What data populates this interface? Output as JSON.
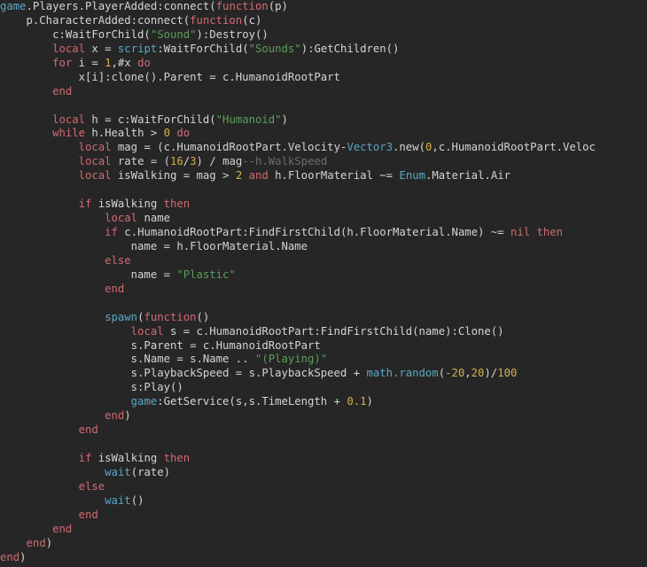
{
  "editor": {
    "language": "Lua",
    "background_color": "#262626",
    "foreground_color": "#d4d4d4",
    "font_size_px": 12,
    "line_height_px": 16,
    "tab_size": 4,
    "gutter_visible": false,
    "word_wrap": false,
    "theme_colors": {
      "keyword": "#d16a72",
      "builtin": "#5aa7c4",
      "string": "#5a9e5a",
      "number": "#d4b14a",
      "comment": "#6d6d6d",
      "plain": "#d4d4d4",
      "background": "#262626"
    }
  },
  "code": {
    "lines": [
      {
        "n": 1,
        "text": "game.Players.PlayerAdded:connect(function(p)"
      },
      {
        "n": 2,
        "text": "    p.CharacterAdded:connect(function(c)"
      },
      {
        "n": 3,
        "text": "        c:WaitForChild(\"Sound\"):Destroy()"
      },
      {
        "n": 4,
        "text": "        local x = script:WaitForChild(\"Sounds\"):GetChildren()"
      },
      {
        "n": 5,
        "text": "        for i = 1,#x do"
      },
      {
        "n": 6,
        "text": "            x[i]:clone().Parent = c.HumanoidRootPart"
      },
      {
        "n": 7,
        "text": "        end"
      },
      {
        "n": 8,
        "text": ""
      },
      {
        "n": 9,
        "text": "        local h = c:WaitForChild(\"Humanoid\")"
      },
      {
        "n": 10,
        "text": "        while h.Health > 0 do"
      },
      {
        "n": 11,
        "text": "            local mag = (c.HumanoidRootPart.Velocity-Vector3.new(0,c.HumanoidRootPart.Veloc"
      },
      {
        "n": 12,
        "text": "            local rate = (16/3) / mag--h.WalkSpeed"
      },
      {
        "n": 13,
        "text": "            local isWalking = mag > 2 and h.FloorMaterial ~= Enum.Material.Air"
      },
      {
        "n": 14,
        "text": ""
      },
      {
        "n": 15,
        "text": "            if isWalking then"
      },
      {
        "n": 16,
        "text": "                local name"
      },
      {
        "n": 17,
        "text": "                if c.HumanoidRootPart:FindFirstChild(h.FloorMaterial.Name) ~= nil then"
      },
      {
        "n": 18,
        "text": "                    name = h.FloorMaterial.Name"
      },
      {
        "n": 19,
        "text": "                else"
      },
      {
        "n": 20,
        "text": "                    name = \"Plastic\""
      },
      {
        "n": 21,
        "text": "                end"
      },
      {
        "n": 22,
        "text": ""
      },
      {
        "n": 23,
        "text": "                spawn(function()"
      },
      {
        "n": 24,
        "text": "                    local s = c.HumanoidRootPart:FindFirstChild(name):Clone()"
      },
      {
        "n": 25,
        "text": "                    s.Parent = c.HumanoidRootPart"
      },
      {
        "n": 26,
        "text": "                    s.Name = s.Name .. \"(Playing)\""
      },
      {
        "n": 27,
        "text": "                    s.PlaybackSpeed = s.PlaybackSpeed + math.random(-20,20)/100"
      },
      {
        "n": 28,
        "text": "                    s:Play()"
      },
      {
        "n": 29,
        "text": "                    game:GetService(s,s.TimeLength + 0.1)"
      },
      {
        "n": 30,
        "text": "                end)"
      },
      {
        "n": 31,
        "text": "            end"
      },
      {
        "n": 32,
        "text": ""
      },
      {
        "n": 33,
        "text": "            if isWalking then"
      },
      {
        "n": 34,
        "text": "                wait(rate)"
      },
      {
        "n": 35,
        "text": "            else"
      },
      {
        "n": 36,
        "text": "                wait()"
      },
      {
        "n": 37,
        "text": "            end"
      },
      {
        "n": 38,
        "text": "        end"
      },
      {
        "n": 39,
        "text": "    end)"
      },
      {
        "n": 40,
        "text": "end)"
      }
    ],
    "tokens": [
      [
        {
          "t": "game",
          "c": "bi"
        },
        {
          "t": ".Players.PlayerAdded:connect(",
          "c": "pln"
        },
        {
          "t": "function",
          "c": "kw"
        },
        {
          "t": "(p)",
          "c": "pln"
        }
      ],
      [
        {
          "t": "    p.CharacterAdded:connect(",
          "c": "pln"
        },
        {
          "t": "function",
          "c": "kw"
        },
        {
          "t": "(c)",
          "c": "pln"
        }
      ],
      [
        {
          "t": "        c:WaitForChild(",
          "c": "pln"
        },
        {
          "t": "\"Sound\"",
          "c": "str"
        },
        {
          "t": "):Destroy()",
          "c": "pln"
        }
      ],
      [
        {
          "t": "        ",
          "c": "pln"
        },
        {
          "t": "local",
          "c": "kw"
        },
        {
          "t": " x = ",
          "c": "pln"
        },
        {
          "t": "script",
          "c": "bi"
        },
        {
          "t": ":WaitForChild(",
          "c": "pln"
        },
        {
          "t": "\"Sounds\"",
          "c": "str"
        },
        {
          "t": "):GetChildren()",
          "c": "pln"
        }
      ],
      [
        {
          "t": "        ",
          "c": "pln"
        },
        {
          "t": "for",
          "c": "kw"
        },
        {
          "t": " i = ",
          "c": "pln"
        },
        {
          "t": "1",
          "c": "num"
        },
        {
          "t": ",#x ",
          "c": "pln"
        },
        {
          "t": "do",
          "c": "kw"
        }
      ],
      [
        {
          "t": "            x[i]:clone().Parent = c.HumanoidRootPart",
          "c": "pln"
        }
      ],
      [
        {
          "t": "        ",
          "c": "pln"
        },
        {
          "t": "end",
          "c": "kw"
        }
      ],
      [
        {
          "t": "",
          "c": "pln"
        }
      ],
      [
        {
          "t": "        ",
          "c": "pln"
        },
        {
          "t": "local",
          "c": "kw"
        },
        {
          "t": " h = c:WaitForChild(",
          "c": "pln"
        },
        {
          "t": "\"Humanoid\"",
          "c": "str"
        },
        {
          "t": ")",
          "c": "pln"
        }
      ],
      [
        {
          "t": "        ",
          "c": "pln"
        },
        {
          "t": "while",
          "c": "kw"
        },
        {
          "t": " h.Health > ",
          "c": "pln"
        },
        {
          "t": "0",
          "c": "num"
        },
        {
          "t": " ",
          "c": "pln"
        },
        {
          "t": "do",
          "c": "kw"
        }
      ],
      [
        {
          "t": "            ",
          "c": "pln"
        },
        {
          "t": "local",
          "c": "kw"
        },
        {
          "t": " mag = (c.HumanoidRootPart.Velocity-",
          "c": "pln"
        },
        {
          "t": "Vector3",
          "c": "bi"
        },
        {
          "t": ".new(",
          "c": "pln"
        },
        {
          "t": "0",
          "c": "num"
        },
        {
          "t": ",c.HumanoidRootPart.Veloc",
          "c": "pln"
        }
      ],
      [
        {
          "t": "            ",
          "c": "pln"
        },
        {
          "t": "local",
          "c": "kw"
        },
        {
          "t": " rate = (",
          "c": "pln"
        },
        {
          "t": "16",
          "c": "num"
        },
        {
          "t": "/",
          "c": "pln"
        },
        {
          "t": "3",
          "c": "num"
        },
        {
          "t": ") / mag",
          "c": "pln"
        },
        {
          "t": "--h.WalkSpeed",
          "c": "cmt"
        }
      ],
      [
        {
          "t": "            ",
          "c": "pln"
        },
        {
          "t": "local",
          "c": "kw"
        },
        {
          "t": " isWalking = mag > ",
          "c": "pln"
        },
        {
          "t": "2",
          "c": "num"
        },
        {
          "t": " ",
          "c": "pln"
        },
        {
          "t": "and",
          "c": "kw"
        },
        {
          "t": " h.FloorMaterial ~= ",
          "c": "pln"
        },
        {
          "t": "Enum",
          "c": "bi"
        },
        {
          "t": ".Material.Air",
          "c": "pln"
        }
      ],
      [
        {
          "t": "",
          "c": "pln"
        }
      ],
      [
        {
          "t": "            ",
          "c": "pln"
        },
        {
          "t": "if",
          "c": "kw"
        },
        {
          "t": " isWalking ",
          "c": "pln"
        },
        {
          "t": "then",
          "c": "kw"
        }
      ],
      [
        {
          "t": "                ",
          "c": "pln"
        },
        {
          "t": "local",
          "c": "kw"
        },
        {
          "t": " name",
          "c": "pln"
        }
      ],
      [
        {
          "t": "                ",
          "c": "pln"
        },
        {
          "t": "if",
          "c": "kw"
        },
        {
          "t": " c.HumanoidRootPart:FindFirstChild(h.FloorMaterial.Name) ~= ",
          "c": "pln"
        },
        {
          "t": "nil",
          "c": "kw"
        },
        {
          "t": " ",
          "c": "pln"
        },
        {
          "t": "then",
          "c": "kw"
        }
      ],
      [
        {
          "t": "                    name = h.FloorMaterial.Name",
          "c": "pln"
        }
      ],
      [
        {
          "t": "                ",
          "c": "pln"
        },
        {
          "t": "else",
          "c": "kw"
        }
      ],
      [
        {
          "t": "                    name = ",
          "c": "pln"
        },
        {
          "t": "\"Plastic\"",
          "c": "str"
        }
      ],
      [
        {
          "t": "                ",
          "c": "pln"
        },
        {
          "t": "end",
          "c": "kw"
        }
      ],
      [
        {
          "t": "",
          "c": "pln"
        }
      ],
      [
        {
          "t": "                ",
          "c": "pln"
        },
        {
          "t": "spawn",
          "c": "bi"
        },
        {
          "t": "(",
          "c": "pln"
        },
        {
          "t": "function",
          "c": "kw"
        },
        {
          "t": "()",
          "c": "pln"
        }
      ],
      [
        {
          "t": "                    ",
          "c": "pln"
        },
        {
          "t": "local",
          "c": "kw"
        },
        {
          "t": " s = c.HumanoidRootPart:FindFirstChild(name):Clone()",
          "c": "pln"
        }
      ],
      [
        {
          "t": "                    s.Parent = c.HumanoidRootPart",
          "c": "pln"
        }
      ],
      [
        {
          "t": "                    s.Name = s.Name .. ",
          "c": "pln"
        },
        {
          "t": "\"(Playing)\"",
          "c": "str"
        }
      ],
      [
        {
          "t": "                    s.PlaybackSpeed = s.PlaybackSpeed + ",
          "c": "pln"
        },
        {
          "t": "math.random",
          "c": "bi"
        },
        {
          "t": "(",
          "c": "pln"
        },
        {
          "t": "-20",
          "c": "num"
        },
        {
          "t": ",",
          "c": "pln"
        },
        {
          "t": "20",
          "c": "num"
        },
        {
          "t": ")/",
          "c": "pln"
        },
        {
          "t": "100",
          "c": "num"
        }
      ],
      [
        {
          "t": "                    s:Play()",
          "c": "pln"
        }
      ],
      [
        {
          "t": "                    ",
          "c": "pln"
        },
        {
          "t": "game",
          "c": "bi"
        },
        {
          "t": ":GetService(s,s.TimeLength + ",
          "c": "pln"
        },
        {
          "t": "0.1",
          "c": "num"
        },
        {
          "t": ")",
          "c": "pln"
        }
      ],
      [
        {
          "t": "                ",
          "c": "pln"
        },
        {
          "t": "end",
          "c": "kw"
        },
        {
          "t": ")",
          "c": "pln"
        }
      ],
      [
        {
          "t": "            ",
          "c": "pln"
        },
        {
          "t": "end",
          "c": "kw"
        }
      ],
      [
        {
          "t": "",
          "c": "pln"
        }
      ],
      [
        {
          "t": "            ",
          "c": "pln"
        },
        {
          "t": "if",
          "c": "kw"
        },
        {
          "t": " isWalking ",
          "c": "pln"
        },
        {
          "t": "then",
          "c": "kw"
        }
      ],
      [
        {
          "t": "                ",
          "c": "pln"
        },
        {
          "t": "wait",
          "c": "bi"
        },
        {
          "t": "(rate)",
          "c": "pln"
        }
      ],
      [
        {
          "t": "            ",
          "c": "pln"
        },
        {
          "t": "else",
          "c": "kw"
        }
      ],
      [
        {
          "t": "                ",
          "c": "pln"
        },
        {
          "t": "wait",
          "c": "bi"
        },
        {
          "t": "()",
          "c": "pln"
        }
      ],
      [
        {
          "t": "            ",
          "c": "pln"
        },
        {
          "t": "end",
          "c": "kw"
        }
      ],
      [
        {
          "t": "        ",
          "c": "pln"
        },
        {
          "t": "end",
          "c": "kw"
        }
      ],
      [
        {
          "t": "    ",
          "c": "pln"
        },
        {
          "t": "end",
          "c": "kw"
        },
        {
          "t": ")",
          "c": "pln"
        }
      ],
      [
        {
          "t": "",
          "c": "pln"
        },
        {
          "t": "end",
          "c": "kw"
        },
        {
          "t": ")",
          "c": "pln"
        }
      ]
    ]
  }
}
